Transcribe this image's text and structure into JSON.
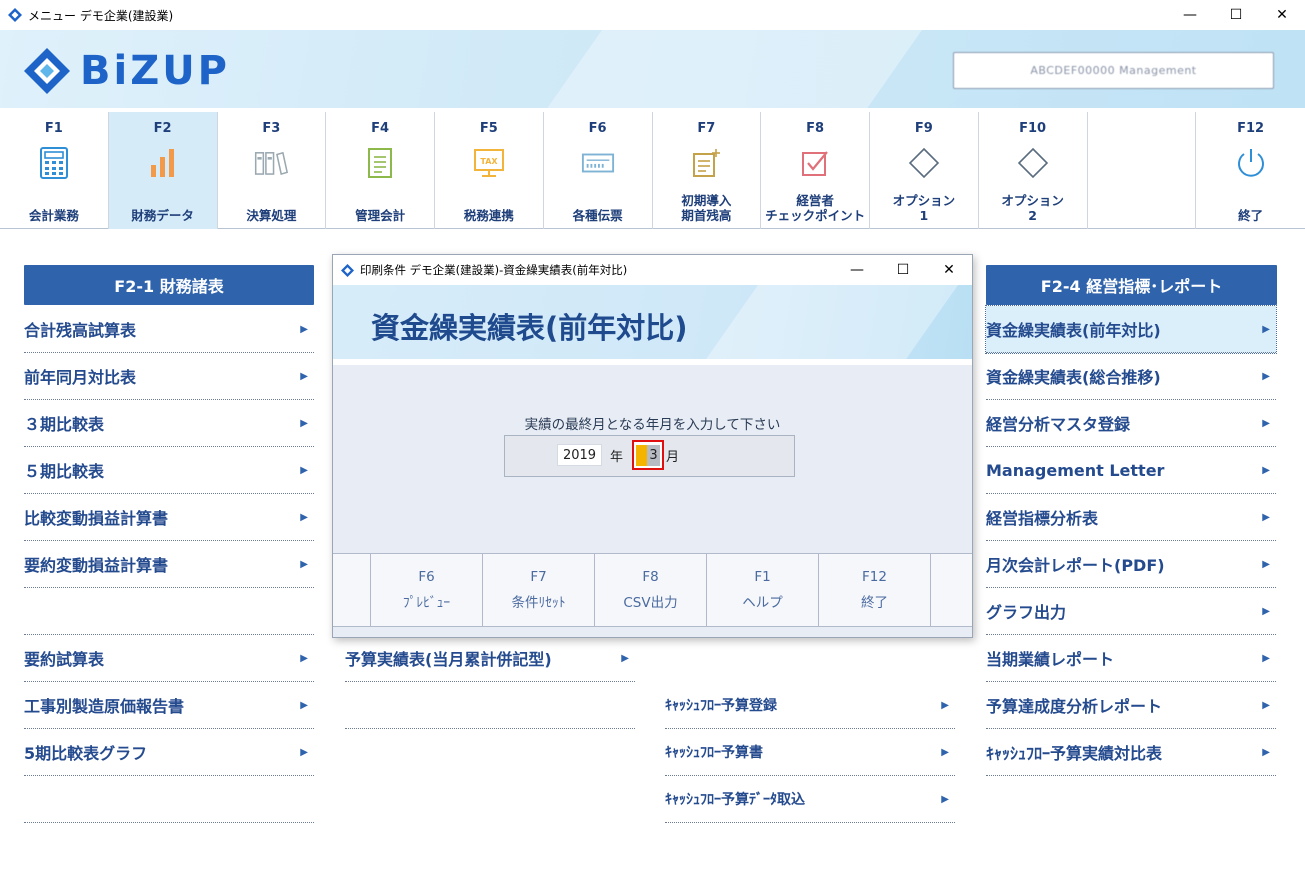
{
  "window": {
    "title": "メニュー デモ企業(建設業)",
    "minimize": "—",
    "maximize": "☐",
    "close": "✕"
  },
  "header": {
    "logo": "BiZUP",
    "user_info": "ABCDEF00000 Management"
  },
  "fkeys": [
    {
      "code": "F1",
      "label": "会計業務",
      "icon": "calculator-icon",
      "active": false
    },
    {
      "code": "F2",
      "label": "財務データ",
      "icon": "bar-chart-icon",
      "active": true
    },
    {
      "code": "F3",
      "label": "決算処理",
      "icon": "binders-icon",
      "active": false
    },
    {
      "code": "F4",
      "label": "管理会計",
      "icon": "document-icon",
      "active": false
    },
    {
      "code": "F5",
      "label": "税務連携",
      "icon": "tax-monitor-icon",
      "active": false
    },
    {
      "code": "F6",
      "label": "各種伝票",
      "icon": "voucher-icon",
      "active": false
    },
    {
      "code": "F7",
      "label": "初期導入\n期首残高",
      "icon": "note-add-icon",
      "active": false
    },
    {
      "code": "F8",
      "label": "経営者\nチェックポイント",
      "icon": "checkbox-icon",
      "active": false
    },
    {
      "code": "F9",
      "label": "オプション\n1",
      "icon": "diamond-icon",
      "active": false
    },
    {
      "code": "F10",
      "label": "オプション\n2",
      "icon": "diamond-icon",
      "active": false
    },
    {
      "code": "F12",
      "label": "終了",
      "icon": "power-icon",
      "active": false
    }
  ],
  "left_section": {
    "title": "F2-1 財務諸表",
    "items": [
      "合計残高試算表",
      "前年同月対比表",
      "３期比較表",
      "５期比較表",
      "比較変動損益計算書",
      "要約変動損益計算書",
      "",
      "要約試算表",
      "工事別製造原価報告書",
      "5期比較表グラフ",
      ""
    ]
  },
  "middle_section": {
    "items": [
      "予算実績表(当月累計併記型)",
      ""
    ]
  },
  "middle2_section": {
    "items": [
      "ｷｬｯｼｭﾌﾛｰ予算登録",
      "ｷｬｯｼｭﾌﾛｰ予算書",
      "ｷｬｯｼｭﾌﾛｰ予算ﾃﾞｰﾀ取込"
    ]
  },
  "right_section": {
    "title": "F2-4 経営指標･レポート",
    "items": [
      "資金繰実績表(前年対比)",
      "資金繰実績表(総合推移)",
      "経営分析マスタ登録",
      "Management Letter",
      "経営指標分析表",
      "月次会計レポート(PDF)",
      "グラフ出力",
      "当期業績レポート",
      "予算達成度分析レポート",
      "ｷｬｯｼｭﾌﾛｰ予算実績対比表"
    ]
  },
  "dialog": {
    "title": "印刷条件 デモ企業(建設業)-資金繰実績表(前年対比)",
    "heading": "資金繰実績表(前年対比)",
    "prompt": "実績の最終月となる年月を入力して下さい",
    "year_value": "2019",
    "year_label": "年",
    "month_value": "3",
    "month_label": "月",
    "buttons": [
      {
        "key": "F6",
        "label": "ﾌﾟﾚﾋﾞｭｰ"
      },
      {
        "key": "F7",
        "label": "条件ﾘｾｯﾄ"
      },
      {
        "key": "F8",
        "label": "CSV出力"
      },
      {
        "key": "F1",
        "label": "ヘルプ"
      },
      {
        "key": "F12",
        "label": "終了"
      }
    ]
  },
  "colors": {
    "accent": "#2f63ac",
    "text": "#254b8f",
    "active_bg": "#d5ebf8"
  }
}
